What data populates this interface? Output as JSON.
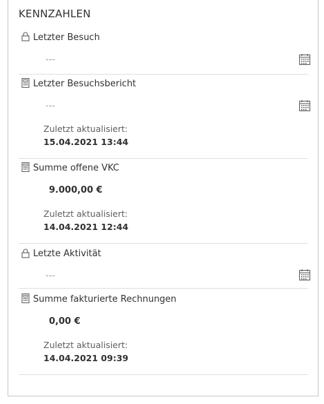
{
  "panel": {
    "title": "KENNZAHLEN"
  },
  "fields": {
    "letzter_besuch": {
      "label": "Letzter Besuch",
      "icon": "lock-icon",
      "value": "---"
    },
    "letzter_besuchsbericht": {
      "label": "Letzter Besuchsbericht",
      "icon": "calculator-icon",
      "value": "---",
      "updated_label": "Zuletzt aktualisiert:",
      "updated_value": "15.04.2021 13:44"
    },
    "summe_offene_vkc": {
      "label": "Summe offene VKC",
      "icon": "calculator-icon",
      "value": "9.000,00 €",
      "updated_label": "Zuletzt aktualisiert:",
      "updated_value": "14.04.2021 12:44"
    },
    "letzte_aktivitaet": {
      "label": "Letzte Aktivität",
      "icon": "lock-icon",
      "value": "---"
    },
    "summe_fakturierte_rechnungen": {
      "label": "Summe fakturierte Rechnungen",
      "icon": "calculator-icon",
      "value": "0,00 €",
      "updated_label": "Zuletzt aktualisiert:",
      "updated_value": "14.04.2021 09:39"
    }
  },
  "colors": {
    "border": "#c8c6c4",
    "divider": "#e1dfdd",
    "text": "#323130",
    "muted": "#a19f9d"
  }
}
